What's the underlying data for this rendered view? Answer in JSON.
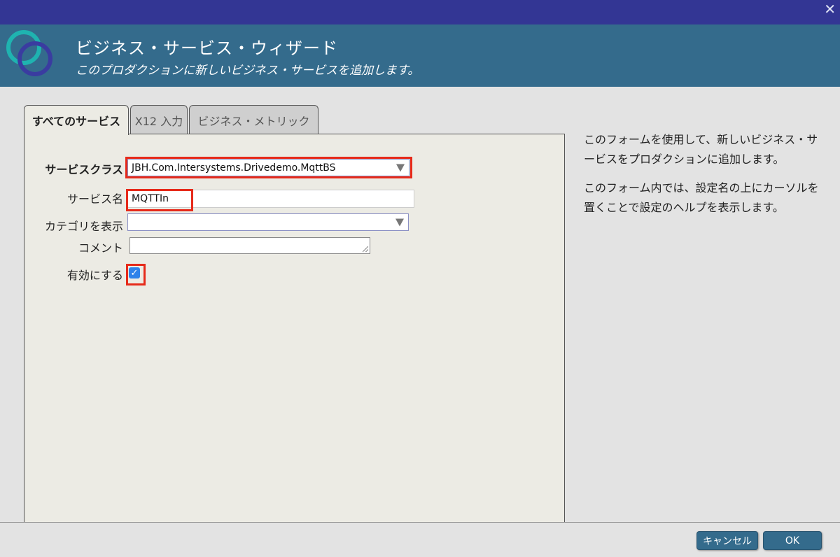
{
  "header": {
    "title": "ビジネス・サービス・ウィザード",
    "subtitle": "このプロダクションに新しいビジネス・サービスを追加します。"
  },
  "tabs": [
    {
      "label": "すべてのサービス",
      "active": true
    },
    {
      "label": "X12 入力",
      "active": false
    },
    {
      "label": "ビジネス・メトリック",
      "active": false
    }
  ],
  "form": {
    "service_class_label": "サービスクラス",
    "service_class_value": "JBH.Com.Intersystems.Drivedemo.MqttBS",
    "service_name_label": "サービス名",
    "service_name_value": "MQTTIn",
    "category_label": "カテゴリを表示",
    "category_value": "",
    "comment_label": "コメント",
    "comment_value": "",
    "enable_label": "有効にする",
    "enabled": true
  },
  "help": {
    "para1": "このフォームを使用して、新しいビジネス・サービスをプロダクションに追加します。",
    "para2": "このフォーム内では、設定名の上にカーソルを置くことで設定のヘルプを表示します。"
  },
  "footer": {
    "cancel_label": "キャンセル",
    "ok_label": "OK"
  },
  "colors": {
    "topbar": "#333694",
    "header": "#346b8c",
    "highlight": "#e62a1a",
    "checkbox": "#2f82ea"
  }
}
